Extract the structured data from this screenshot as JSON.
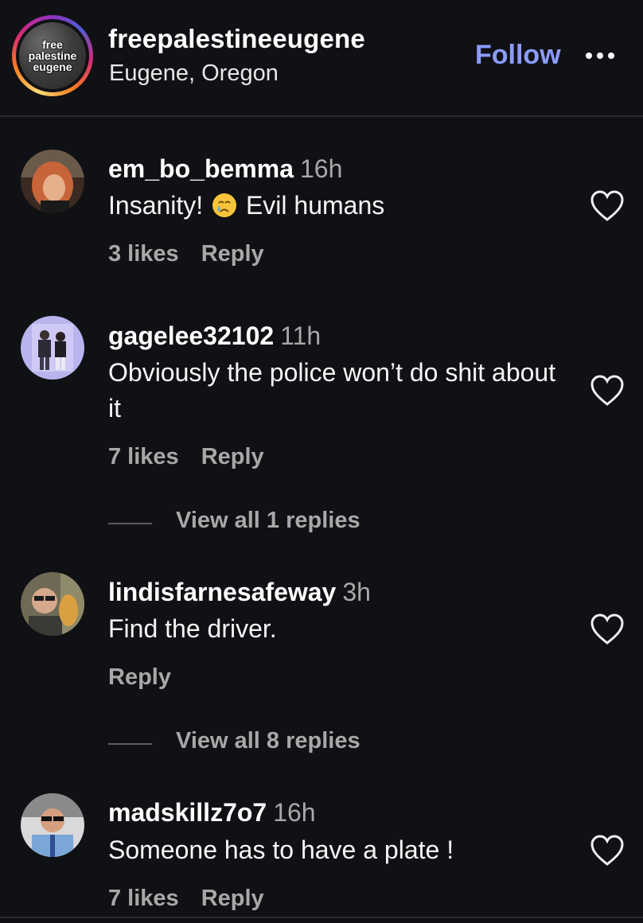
{
  "header": {
    "avatar_text": "free\npalestine\neugene",
    "username": "freepalestineeugene",
    "location": "Eugene, Oregon",
    "follow_label": "Follow",
    "more_icon": "more-horizontal-icon"
  },
  "comments": [
    {
      "username": "em_bo_bemma",
      "time": "16h",
      "text_before_emoji": "Insanity!",
      "emoji": "crying-face-emoji",
      "text_after_emoji": "Evil humans",
      "likes": "3 likes",
      "reply_label": "Reply"
    },
    {
      "username": "gagelee32102",
      "time": "11h",
      "text": "Obviously the police won’t do shit about it",
      "likes": "7 likes",
      "reply_label": "Reply",
      "view_replies": "View all 1 replies"
    },
    {
      "username": "lindisfarnesafeway",
      "time": "3h",
      "text": "Find the driver.",
      "reply_label": "Reply",
      "view_replies": "View all 8 replies"
    },
    {
      "username": "madskillz7o7",
      "time": "16h",
      "text": "Someone has to have a plate !",
      "likes": "7 likes",
      "reply_label": "Reply"
    }
  ],
  "colors": {
    "background": "#101114",
    "accent": "#8c9bff",
    "secondary_text": "#a8a8a8"
  }
}
